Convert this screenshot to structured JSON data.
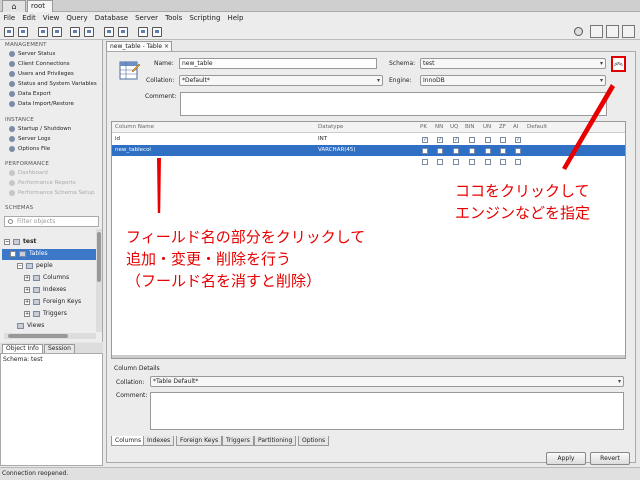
{
  "tabs": {
    "home_icon": "home-icon",
    "connection": "root",
    "close": "×"
  },
  "menu": [
    "File",
    "Edit",
    "View",
    "Query",
    "Database",
    "Server",
    "Tools",
    "Scripting",
    "Help"
  ],
  "sidebar": {
    "management_title": "MANAGEMENT",
    "management_items": [
      "Server Status",
      "Client Connections",
      "Users and Privileges",
      "Status and System Variables",
      "Data Export",
      "Data Import/Restore"
    ],
    "instance_title": "INSTANCE",
    "instance_items": [
      "Startup / Shutdown",
      "Server Logs",
      "Options File"
    ],
    "performance_title": "PERFORMANCE",
    "performance_items": [
      "Dashboard",
      "Performance Reports",
      "Performance Schema Setup"
    ],
    "schemas_title": "SCHEMAS",
    "filter_placeholder": "Filter objects",
    "tree": {
      "schema": "test",
      "tables": "Tables",
      "table": "peple",
      "columns": "Columns",
      "indexes": "Indexes",
      "foreign_keys": "Foreign Keys",
      "triggers": "Triggers",
      "views": "Views"
    },
    "info_tabs": [
      "Object Info",
      "Session"
    ],
    "info_text": "Schema: test"
  },
  "editor": {
    "tab_label": "new_table - Table",
    "name_label": "Name:",
    "name_value": "new_table",
    "schema_label": "Schema:",
    "schema_value": "test",
    "collation_label": "Collation:",
    "collation_value": "*Default*",
    "engine_label": "Engine:",
    "engine_value": "InnoDB",
    "comment_label": "Comment:",
    "collapse_icon": "double-chevron-up-icon",
    "columns_header": [
      "Column Name",
      "Datatype",
      "PK",
      "NN",
      "UQ",
      "BIN",
      "UN",
      "ZF",
      "AI",
      "Default"
    ],
    "rows": [
      {
        "name": "id",
        "type": "INT",
        "flags": [
          true,
          true,
          true,
          false,
          false,
          false,
          true
        ]
      },
      {
        "name": "new_tablecol",
        "type": "VARCHAR(45)",
        "flags": [
          false,
          false,
          false,
          false,
          false,
          false,
          false
        ]
      }
    ],
    "column_details_title": "Column Details",
    "ct_collation_label": "Collation:",
    "ct_collation_value": "*Table Default*",
    "ct_comment_label": "Comment:",
    "bottom_tabs": [
      "Columns",
      "Indexes",
      "Foreign Keys",
      "Triggers",
      "Partitioning",
      "Options"
    ],
    "apply": "Apply",
    "revert": "Revert"
  },
  "status": "Connection reopened.",
  "annotations": {
    "note1_line1": "フィールド名の部分をクリックして",
    "note1_line2": "追加・変更・削除を行う",
    "note1_line3": "（フールド名を消すと削除）",
    "note2_line1": "ココをクリックして",
    "note2_line2": "エンジンなどを指定"
  },
  "colors": {
    "accent": "#3d77c7",
    "annotation": "#e80000"
  }
}
